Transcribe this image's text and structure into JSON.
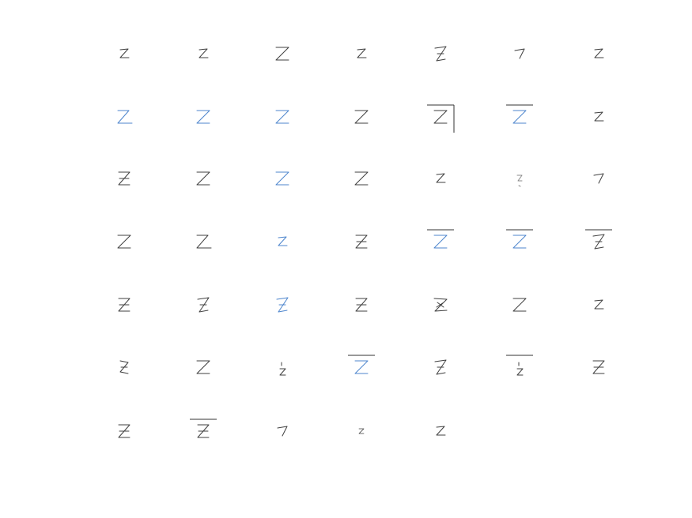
{
  "figure": {
    "grid": {
      "rows": 7,
      "columns": 7,
      "filled_cells": 47
    },
    "ink_colors": {
      "dark": "#2a2a2a",
      "blue": "#3a78c8"
    },
    "samples": [
      {
        "ink": "dark",
        "bar": false,
        "box": false,
        "style": "small"
      },
      {
        "ink": "dark",
        "bar": false,
        "box": false,
        "style": "small"
      },
      {
        "ink": "dark",
        "bar": false,
        "box": false,
        "style": "plain"
      },
      {
        "ink": "dark",
        "bar": false,
        "box": false,
        "style": "small"
      },
      {
        "ink": "dark",
        "bar": false,
        "box": false,
        "style": "slanted"
      },
      {
        "ink": "dark",
        "bar": false,
        "box": false,
        "style": "seven"
      },
      {
        "ink": "dark",
        "bar": false,
        "box": false,
        "style": "small"
      },
      {
        "ink": "blue",
        "bar": false,
        "box": false,
        "style": "tailed"
      },
      {
        "ink": "blue",
        "bar": false,
        "box": false,
        "style": "plain"
      },
      {
        "ink": "blue",
        "bar": false,
        "box": false,
        "style": "plain"
      },
      {
        "ink": "dark",
        "bar": false,
        "box": false,
        "style": "plain"
      },
      {
        "ink": "dark",
        "bar": true,
        "box": true,
        "style": "plain"
      },
      {
        "ink": "blue",
        "bar": true,
        "box": false,
        "style": "plain"
      },
      {
        "ink": "dark",
        "bar": false,
        "box": false,
        "style": "small"
      },
      {
        "ink": "dark",
        "bar": false,
        "box": false,
        "style": "crossed"
      },
      {
        "ink": "dark",
        "bar": false,
        "box": false,
        "style": "plain"
      },
      {
        "ink": "blue",
        "bar": false,
        "box": false,
        "style": "plain"
      },
      {
        "ink": "dark",
        "bar": false,
        "box": false,
        "style": "plain"
      },
      {
        "ink": "dark",
        "bar": false,
        "box": false,
        "style": "small"
      },
      {
        "ink": "dark",
        "bar": false,
        "box": false,
        "style": "faint"
      },
      {
        "ink": "dark",
        "bar": false,
        "box": false,
        "style": "seven"
      },
      {
        "ink": "dark",
        "bar": false,
        "box": false,
        "style": "plain"
      },
      {
        "ink": "dark",
        "bar": false,
        "box": false,
        "style": "tailed"
      },
      {
        "ink": "blue",
        "bar": false,
        "box": false,
        "style": "small"
      },
      {
        "ink": "dark",
        "bar": false,
        "box": false,
        "style": "crossed"
      },
      {
        "ink": "blue",
        "bar": true,
        "box": false,
        "style": "plain"
      },
      {
        "ink": "blue",
        "bar": true,
        "box": false,
        "style": "plain"
      },
      {
        "ink": "dark",
        "bar": true,
        "box": false,
        "style": "slanted"
      },
      {
        "ink": "dark",
        "bar": false,
        "box": false,
        "style": "crossed"
      },
      {
        "ink": "dark",
        "bar": false,
        "box": false,
        "style": "slanted"
      },
      {
        "ink": "blue",
        "bar": false,
        "box": false,
        "style": "slanted"
      },
      {
        "ink": "dark",
        "bar": false,
        "box": false,
        "style": "crossed"
      },
      {
        "ink": "dark",
        "bar": false,
        "box": false,
        "style": "scribble"
      },
      {
        "ink": "dark",
        "bar": false,
        "box": false,
        "style": "plain"
      },
      {
        "ink": "dark",
        "bar": false,
        "box": false,
        "style": "small"
      },
      {
        "ink": "dark",
        "bar": false,
        "box": false,
        "style": "eight"
      },
      {
        "ink": "dark",
        "bar": false,
        "box": false,
        "style": "plain"
      },
      {
        "ink": "dark",
        "bar": false,
        "box": false,
        "style": "low"
      },
      {
        "ink": "blue",
        "bar": true,
        "box": false,
        "style": "plain"
      },
      {
        "ink": "dark",
        "bar": false,
        "box": false,
        "style": "slanted"
      },
      {
        "ink": "dark",
        "bar": true,
        "box": false,
        "style": "low"
      },
      {
        "ink": "dark",
        "bar": false,
        "box": false,
        "style": "crossed"
      },
      {
        "ink": "dark",
        "bar": false,
        "box": false,
        "style": "crossed"
      },
      {
        "ink": "dark",
        "bar": true,
        "box": false,
        "style": "crossed"
      },
      {
        "ink": "dark",
        "bar": false,
        "box": false,
        "style": "seven"
      },
      {
        "ink": "dark",
        "bar": false,
        "box": false,
        "style": "tiny"
      },
      {
        "ink": "dark",
        "bar": false,
        "box": false,
        "style": "small"
      }
    ]
  }
}
